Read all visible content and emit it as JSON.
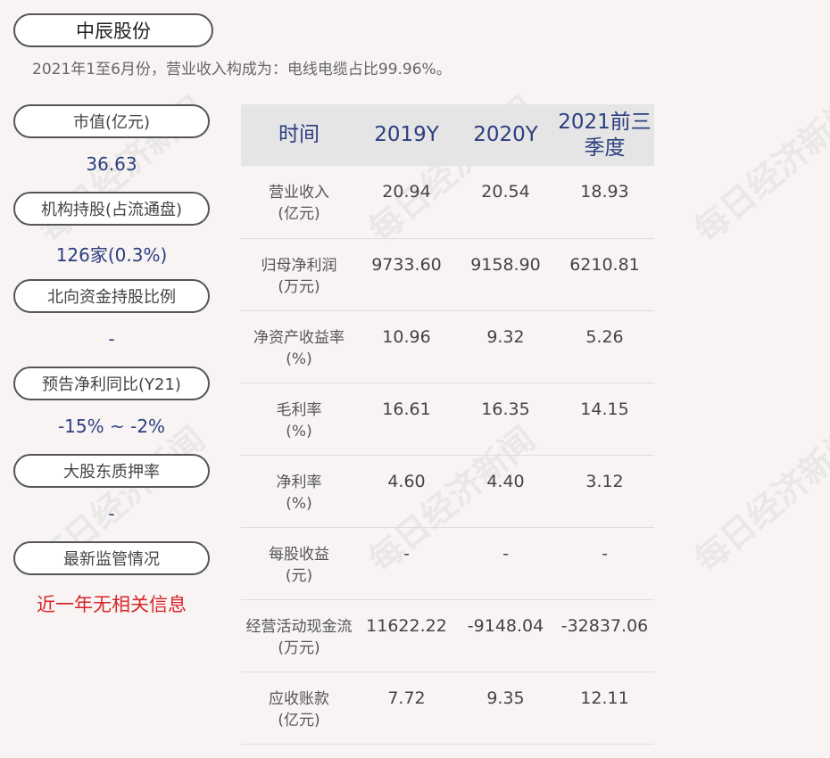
{
  "header": {
    "company": "中辰股份",
    "subtitle": "2021年1至6月份，营业收入构成为：电线电缆占比99.96%。"
  },
  "watermark": "每日经济新闻",
  "sidebar": [
    {
      "label": "市值(亿元)",
      "value": "36.63"
    },
    {
      "label": "机构持股(占流通盘)",
      "value": "126家(0.3%)"
    },
    {
      "label": "北向资金持股比例",
      "value": "-"
    },
    {
      "label": "预告净利同比(Y21)",
      "value": "-15% ~ -2%"
    },
    {
      "label": "大股东质押率",
      "value": "-"
    },
    {
      "label": "最新监管情况",
      "value": "近一年无相关信息"
    }
  ],
  "table": {
    "headers": [
      "时间",
      "2019Y",
      "2020Y",
      "2021前三季度"
    ],
    "rows": [
      {
        "label1": "营业收入",
        "label2": "(亿元)",
        "v": [
          "20.94",
          "20.54",
          "18.93"
        ]
      },
      {
        "label1": "归母净利润",
        "label2": "(万元)",
        "v": [
          "9733.60",
          "9158.90",
          "6210.81"
        ]
      },
      {
        "label1": "净资产收益率",
        "label2": "(%)",
        "v": [
          "10.96",
          "9.32",
          "5.26"
        ]
      },
      {
        "label1": "毛利率",
        "label2": "(%)",
        "v": [
          "16.61",
          "16.35",
          "14.15"
        ]
      },
      {
        "label1": "净利率",
        "label2": "(%)",
        "v": [
          "4.60",
          "4.40",
          "3.12"
        ]
      },
      {
        "label1": "每股收益",
        "label2": "(元)",
        "v": [
          "-",
          "-",
          "-"
        ]
      },
      {
        "label1": "经营活动现金流",
        "label2": "(万元)",
        "v": [
          "11622.22",
          "-9148.04",
          "-32837.06"
        ]
      },
      {
        "label1": "应收账款",
        "label2": "(亿元)",
        "v": [
          "7.72",
          "9.35",
          "12.11"
        ]
      }
    ]
  },
  "colors": {
    "accent": "#2c3e7f",
    "alert": "#d9252a",
    "header_bg": "#e5e5e5",
    "page_bg": "#f8f4f4"
  }
}
